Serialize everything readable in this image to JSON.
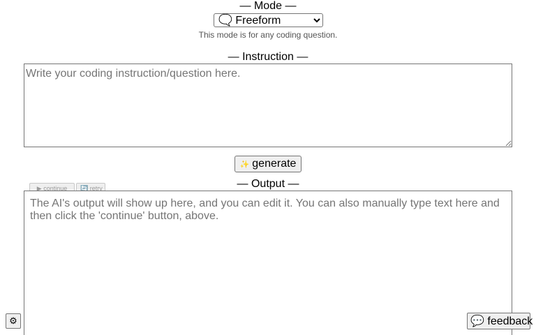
{
  "mode": {
    "title": "— Mode —",
    "selected_option": "🗨️ Freeform",
    "description": "This mode is for any coding question."
  },
  "instruction": {
    "title": "— Instruction —",
    "placeholder": "Write your coding instruction/question here."
  },
  "generate": {
    "icon": "✨",
    "icon_name": "sparkle-icon",
    "label": "generate"
  },
  "output": {
    "title": "— Output —",
    "placeholder": "The AI's output will show up here, and you can edit it. You can also manually type text here and then click the 'continue' button, above.",
    "continue_label": "▶ continue",
    "retry_label": "🔄 retry"
  },
  "footer": {
    "corner_button_label": "⚙",
    "corner_button_icon_name": "settings-icon",
    "feedback_label": "💬 feedback"
  }
}
